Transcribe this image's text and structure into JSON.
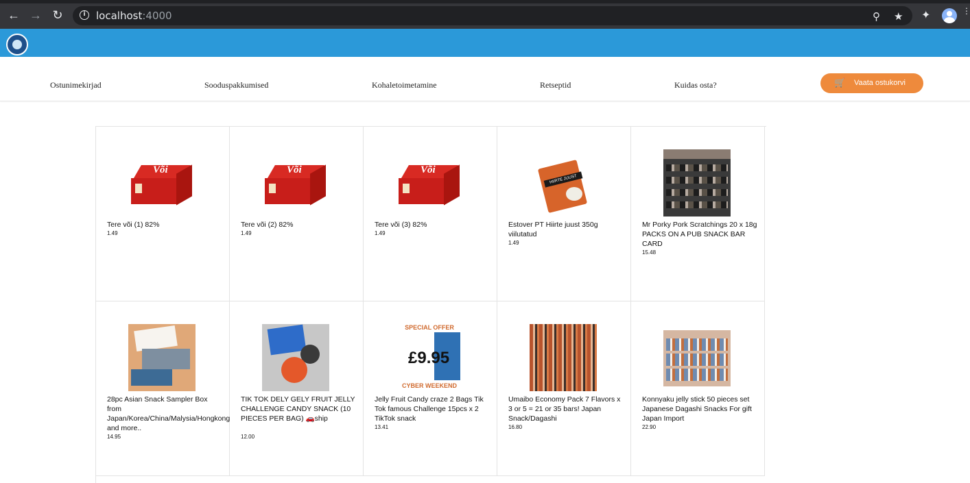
{
  "browser": {
    "url_host": "localhost",
    "url_port": ":4000"
  },
  "nav": {
    "items": [
      "Ostunimekirjad",
      "Sooduspakkumised",
      "Kohaletoimetamine",
      "Retseptid",
      "Kuidas osta?"
    ],
    "cart_button": "Vaata ostukorvi"
  },
  "colors": {
    "header_blue": "#2b99d9",
    "cart_orange": "#ee8a3c"
  },
  "products": [
    {
      "name": "Tere või (1) 82%",
      "price": "1.49"
    },
    {
      "name": "Tere või (2) 82%",
      "price": "1.49"
    },
    {
      "name": "Tere või (3) 82%",
      "price": "1.49"
    },
    {
      "name": "Estover PT Hiirte juust 350g viilutatud",
      "price": "1.49"
    },
    {
      "name": "Mr Porky Pork Scratchings 20 x 18g PACKS ON A PUB SNACK BAR CARD",
      "price": "15.48"
    },
    {
      "name": "28pc Asian Snack Sampler Box from Japan/Korea/China/Malysia/Hongkong and more..",
      "price": "14.95"
    },
    {
      "name": "TIK TOK DELY GELY FRUIT JELLY CHALLENGE CANDY SNACK (10 PIECES PER BAG) 🚗ship",
      "price": "12.00"
    },
    {
      "name": "Jelly Fruit Candy craze 2 Bags Tik Tok famous Challenge 15pcs x 2 TikTok snack",
      "price": "13.41"
    },
    {
      "name": "Umaibo Economy Pack 7 Flavors x 3 or 5 = 21 or 35 bars! Japan Snack/Dagashi",
      "price": "16.80"
    },
    {
      "name": "Konnyaku jelly stick 50 pieces set Japanese Dagashi Snacks For gift Japan Import",
      "price": "22.90"
    }
  ],
  "image_text": {
    "butter_label": "Või",
    "cheese_label": "HIIRTE JUUST",
    "jelly_top": "SPECIAL OFFER",
    "jelly_price": "£9.95",
    "jelly_bottom": "CYBER WEEKEND"
  }
}
